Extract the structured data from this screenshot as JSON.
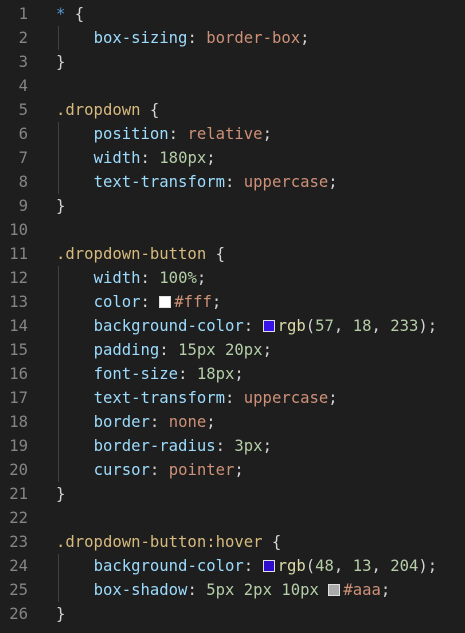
{
  "editor": {
    "colors": {
      "swatch_white": "#fff",
      "swatch_blue": "rgb(57, 18, 233)",
      "swatch_blue_hover": "rgb(48, 13, 204)",
      "swatch_gray": "#aaa"
    },
    "lines": [
      {
        "n": "1",
        "tokens": [
          {
            "t": "*",
            "c": "star"
          },
          {
            "t": " {",
            "c": "brace"
          }
        ]
      },
      {
        "n": "2",
        "tokens": [
          {
            "t": "    ",
            "c": "punc"
          },
          {
            "t": "box-sizing",
            "c": "prop"
          },
          {
            "t": ": ",
            "c": "punc"
          },
          {
            "t": "border-box",
            "c": "val"
          },
          {
            "t": ";",
            "c": "punc"
          }
        ]
      },
      {
        "n": "3",
        "tokens": [
          {
            "t": "}",
            "c": "brace"
          }
        ]
      },
      {
        "n": "4",
        "tokens": []
      },
      {
        "n": "5",
        "tokens": [
          {
            "t": ".dropdown",
            "c": "sel"
          },
          {
            "t": " {",
            "c": "brace"
          }
        ]
      },
      {
        "n": "6",
        "tokens": [
          {
            "t": "    ",
            "c": "punc"
          },
          {
            "t": "position",
            "c": "prop"
          },
          {
            "t": ": ",
            "c": "punc"
          },
          {
            "t": "relative",
            "c": "val"
          },
          {
            "t": ";",
            "c": "punc"
          }
        ]
      },
      {
        "n": "7",
        "tokens": [
          {
            "t": "    ",
            "c": "punc"
          },
          {
            "t": "width",
            "c": "prop"
          },
          {
            "t": ": ",
            "c": "punc"
          },
          {
            "t": "180px",
            "c": "num"
          },
          {
            "t": ";",
            "c": "punc"
          }
        ]
      },
      {
        "n": "8",
        "tokens": [
          {
            "t": "    ",
            "c": "punc"
          },
          {
            "t": "text-transform",
            "c": "prop"
          },
          {
            "t": ": ",
            "c": "punc"
          },
          {
            "t": "uppercase",
            "c": "val"
          },
          {
            "t": ";",
            "c": "punc"
          }
        ]
      },
      {
        "n": "9",
        "tokens": [
          {
            "t": "}",
            "c": "brace"
          }
        ]
      },
      {
        "n": "10",
        "tokens": []
      },
      {
        "n": "11",
        "tokens": [
          {
            "t": ".dropdown-button",
            "c": "sel"
          },
          {
            "t": " {",
            "c": "brace"
          }
        ]
      },
      {
        "n": "12",
        "tokens": [
          {
            "t": "    ",
            "c": "punc"
          },
          {
            "t": "width",
            "c": "prop"
          },
          {
            "t": ": ",
            "c": "punc"
          },
          {
            "t": "100%",
            "c": "num"
          },
          {
            "t": ";",
            "c": "punc"
          }
        ]
      },
      {
        "n": "13",
        "tokens": [
          {
            "t": "    ",
            "c": "punc"
          },
          {
            "t": "color",
            "c": "prop"
          },
          {
            "t": ": ",
            "c": "punc"
          },
          {
            "swatch": "swatch_white"
          },
          {
            "t": "#fff",
            "c": "val"
          },
          {
            "t": ";",
            "c": "punc"
          }
        ]
      },
      {
        "n": "14",
        "tokens": [
          {
            "t": "    ",
            "c": "punc"
          },
          {
            "t": "background-color",
            "c": "prop"
          },
          {
            "t": ": ",
            "c": "punc"
          },
          {
            "swatch": "swatch_blue"
          },
          {
            "t": "rgb",
            "c": "func"
          },
          {
            "t": "(",
            "c": "punc"
          },
          {
            "t": "57",
            "c": "num"
          },
          {
            "t": ", ",
            "c": "punc"
          },
          {
            "t": "18",
            "c": "num"
          },
          {
            "t": ", ",
            "c": "punc"
          },
          {
            "t": "233",
            "c": "num"
          },
          {
            "t": ");",
            "c": "punc"
          }
        ]
      },
      {
        "n": "15",
        "tokens": [
          {
            "t": "    ",
            "c": "punc"
          },
          {
            "t": "padding",
            "c": "prop"
          },
          {
            "t": ": ",
            "c": "punc"
          },
          {
            "t": "15px",
            "c": "num"
          },
          {
            "t": " ",
            "c": "punc"
          },
          {
            "t": "20px",
            "c": "num"
          },
          {
            "t": ";",
            "c": "punc"
          }
        ]
      },
      {
        "n": "16",
        "tokens": [
          {
            "t": "    ",
            "c": "punc"
          },
          {
            "t": "font-size",
            "c": "prop"
          },
          {
            "t": ": ",
            "c": "punc"
          },
          {
            "t": "18px",
            "c": "num"
          },
          {
            "t": ";",
            "c": "punc"
          }
        ]
      },
      {
        "n": "17",
        "tokens": [
          {
            "t": "    ",
            "c": "punc"
          },
          {
            "t": "text-transform",
            "c": "prop"
          },
          {
            "t": ": ",
            "c": "punc"
          },
          {
            "t": "uppercase",
            "c": "val"
          },
          {
            "t": ";",
            "c": "punc"
          }
        ]
      },
      {
        "n": "18",
        "tokens": [
          {
            "t": "    ",
            "c": "punc"
          },
          {
            "t": "border",
            "c": "prop"
          },
          {
            "t": ": ",
            "c": "punc"
          },
          {
            "t": "none",
            "c": "val"
          },
          {
            "t": ";",
            "c": "punc"
          }
        ]
      },
      {
        "n": "19",
        "tokens": [
          {
            "t": "    ",
            "c": "punc"
          },
          {
            "t": "border-radius",
            "c": "prop"
          },
          {
            "t": ": ",
            "c": "punc"
          },
          {
            "t": "3px",
            "c": "num"
          },
          {
            "t": ";",
            "c": "punc"
          }
        ]
      },
      {
        "n": "20",
        "tokens": [
          {
            "t": "    ",
            "c": "punc"
          },
          {
            "t": "cursor",
            "c": "prop"
          },
          {
            "t": ": ",
            "c": "punc"
          },
          {
            "t": "pointer",
            "c": "val"
          },
          {
            "t": ";",
            "c": "punc"
          }
        ]
      },
      {
        "n": "21",
        "tokens": [
          {
            "t": "}",
            "c": "brace"
          }
        ]
      },
      {
        "n": "22",
        "tokens": []
      },
      {
        "n": "23",
        "tokens": [
          {
            "t": ".dropdown-button:hover",
            "c": "sel"
          },
          {
            "t": " {",
            "c": "brace"
          }
        ]
      },
      {
        "n": "24",
        "tokens": [
          {
            "t": "    ",
            "c": "punc"
          },
          {
            "t": "background-color",
            "c": "prop"
          },
          {
            "t": ": ",
            "c": "punc"
          },
          {
            "swatch": "swatch_blue_hover"
          },
          {
            "t": "rgb",
            "c": "func"
          },
          {
            "t": "(",
            "c": "punc"
          },
          {
            "t": "48",
            "c": "num"
          },
          {
            "t": ", ",
            "c": "punc"
          },
          {
            "t": "13",
            "c": "num"
          },
          {
            "t": ", ",
            "c": "punc"
          },
          {
            "t": "204",
            "c": "num"
          },
          {
            "t": ");",
            "c": "punc"
          }
        ]
      },
      {
        "n": "25",
        "tokens": [
          {
            "t": "    ",
            "c": "punc"
          },
          {
            "t": "box-shadow",
            "c": "prop"
          },
          {
            "t": ": ",
            "c": "punc"
          },
          {
            "t": "5px",
            "c": "num"
          },
          {
            "t": " ",
            "c": "punc"
          },
          {
            "t": "2px",
            "c": "num"
          },
          {
            "t": " ",
            "c": "punc"
          },
          {
            "t": "10px",
            "c": "num"
          },
          {
            "t": " ",
            "c": "punc"
          },
          {
            "swatch": "swatch_gray"
          },
          {
            "t": "#aaa",
            "c": "val"
          },
          {
            "t": ";",
            "c": "punc"
          }
        ]
      },
      {
        "n": "26",
        "tokens": [
          {
            "t": "}",
            "c": "brace"
          }
        ]
      }
    ]
  }
}
